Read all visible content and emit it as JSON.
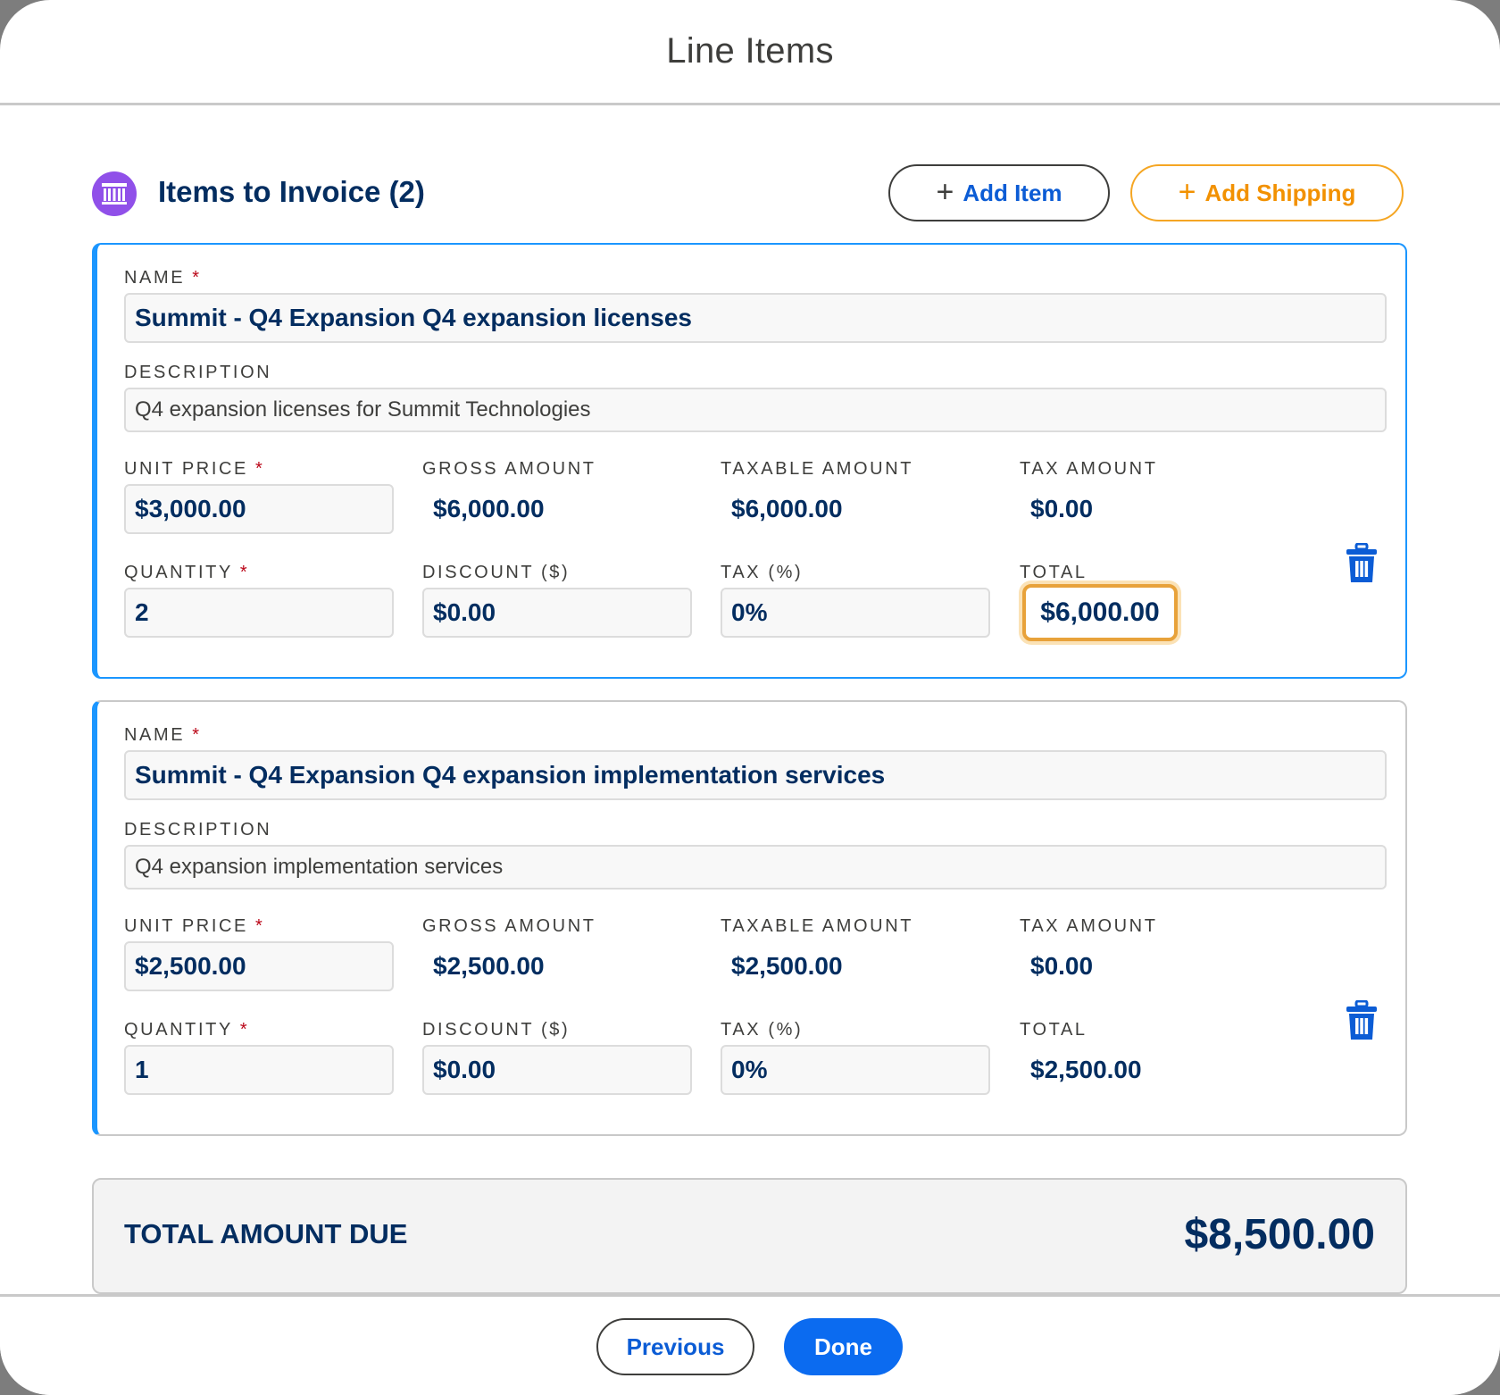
{
  "modal": {
    "title": "Line Items"
  },
  "section": {
    "title": "Items to Invoice (2)",
    "icon": "invoice-icon",
    "add_item_label": "Add Item",
    "add_shipping_label": "Add Shipping"
  },
  "labels": {
    "name": "NAME",
    "description": "DESCRIPTION",
    "unit_price": "UNIT PRICE",
    "gross_amount": "GROSS AMOUNT",
    "taxable_amount": "TAXABLE AMOUNT",
    "tax_amount": "TAX AMOUNT",
    "quantity": "QUANTITY",
    "discount": "DISCOUNT ($)",
    "tax_pct": "TAX (%)",
    "total": "TOTAL",
    "required_mark": "*"
  },
  "items": [
    {
      "name": "Summit - Q4 Expansion Q4 expansion licenses",
      "description": "Q4 expansion licenses for Summit Technologies",
      "unit_price": "$3,000.00",
      "gross_amount": "$6,000.00",
      "taxable_amount": "$6,000.00",
      "tax_amount": "$0.00",
      "quantity": "2",
      "discount": "$0.00",
      "tax_pct": "0%",
      "total": "$6,000.00"
    },
    {
      "name": "Summit - Q4 Expansion Q4 expansion implementation services",
      "description": "Q4 expansion implementation services",
      "unit_price": "$2,500.00",
      "gross_amount": "$2,500.00",
      "taxable_amount": "$2,500.00",
      "tax_amount": "$0.00",
      "quantity": "1",
      "discount": "$0.00",
      "tax_pct": "0%",
      "total": "$2,500.00"
    }
  ],
  "summary": {
    "label": "TOTAL AMOUNT DUE",
    "value": "$8,500.00"
  },
  "footer": {
    "previous_label": "Previous",
    "done_label": "Done"
  },
  "colors": {
    "accent": "#0b6bf0",
    "shipping": "#f29100",
    "icon_bg": "#9050e9",
    "active_border": "#1b96ff"
  }
}
